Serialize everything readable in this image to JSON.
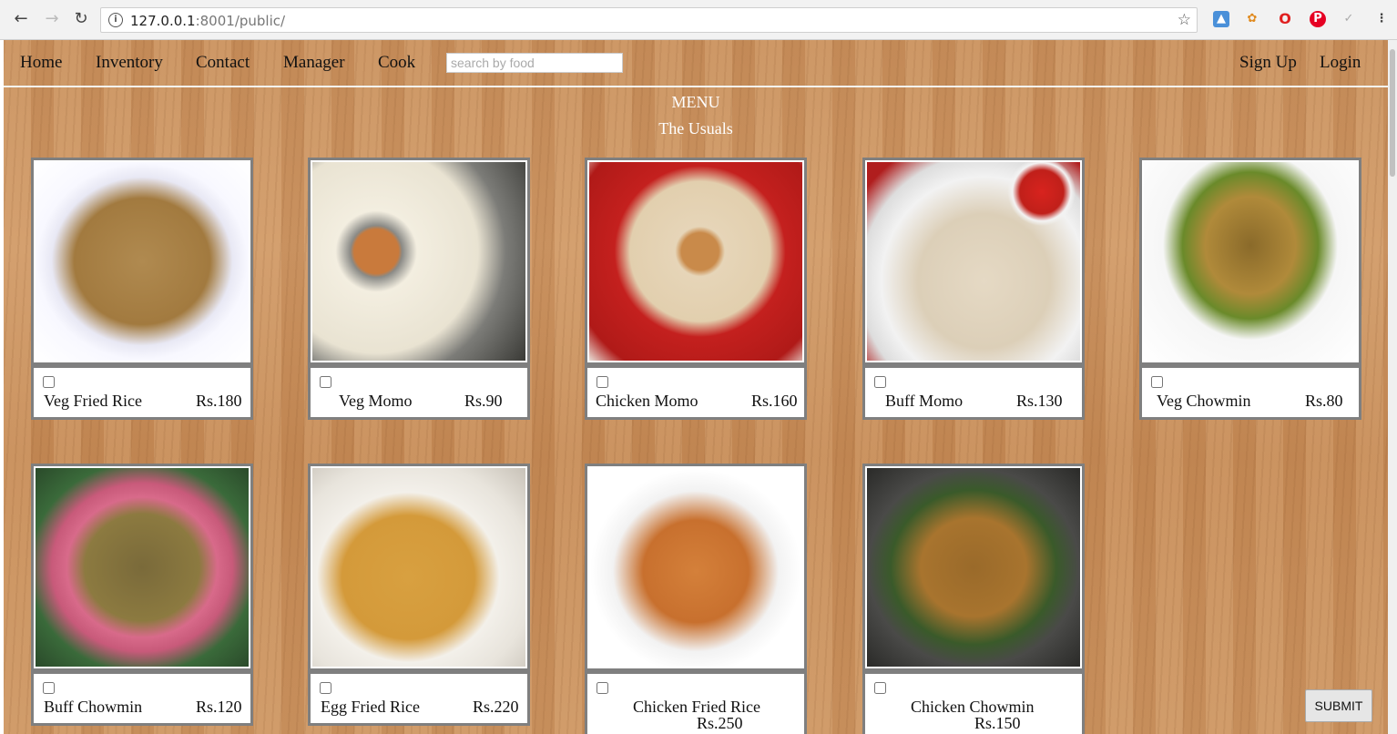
{
  "browser": {
    "url_host": "127.0.0.1",
    "url_port": ":8001",
    "url_path": "/public/"
  },
  "nav": {
    "links": [
      "Home",
      "Inventory",
      "Contact",
      "Manager",
      "Cook"
    ],
    "search_placeholder": "search by food",
    "signup": "Sign Up",
    "login": "Login"
  },
  "menu": {
    "title": "MENU",
    "subtitle": "The Usuals"
  },
  "items": [
    {
      "name": "Veg Fried Rice",
      "price": "Rs.180"
    },
    {
      "name": "Veg Momo",
      "price": "Rs.90"
    },
    {
      "name": "Chicken Momo",
      "price": "Rs.160"
    },
    {
      "name": "Buff Momo",
      "price": "Rs.130"
    },
    {
      "name": "Veg Chowmin",
      "price": "Rs.80"
    },
    {
      "name": "Buff Chowmin",
      "price": "Rs.120"
    },
    {
      "name": "Egg Fried Rice",
      "price": "Rs.220"
    },
    {
      "name": "Chicken Fried Rice",
      "price": "Rs.250"
    },
    {
      "name": "Chicken Chowmin",
      "price": "Rs.150"
    }
  ],
  "submit_label": "SUBMIT"
}
